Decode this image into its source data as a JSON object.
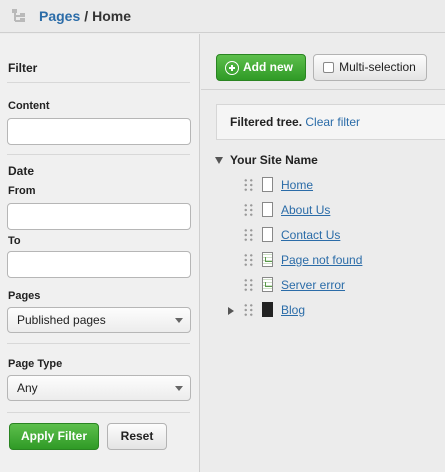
{
  "breadcrumb": {
    "section": "Pages",
    "separator": "/",
    "current": "Home"
  },
  "filter": {
    "heading": "Filter",
    "content_label": "Content",
    "content_value": "",
    "date_label": "Date",
    "from_label": "From",
    "from_value": "",
    "to_label": "To",
    "to_value": "",
    "pages_label": "Pages",
    "pages_selected": "Published pages",
    "page_type_label": "Page Type",
    "page_type_selected": "Any",
    "apply_label": "Apply Filter",
    "reset_label": "Reset"
  },
  "toolbar": {
    "add_new_label": "Add new",
    "multi_selection_label": "Multi-selection"
  },
  "filter_status": {
    "text": "Filtered tree.",
    "clear_link": "Clear filter"
  },
  "tree": {
    "root": "Your Site Name",
    "items": [
      {
        "label": "Home",
        "icon": "page-icon"
      },
      {
        "label": "About Us",
        "icon": "page-icon"
      },
      {
        "label": "Contact Us",
        "icon": "page-icon"
      },
      {
        "label": "Page not found",
        "icon": "error-page-icon"
      },
      {
        "label": "Server error",
        "icon": "error-page-icon"
      },
      {
        "label": "Blog",
        "icon": "holder-page-icon"
      }
    ]
  },
  "colors": {
    "link": "#2b6ca8",
    "button_green": "#3aa52f"
  }
}
